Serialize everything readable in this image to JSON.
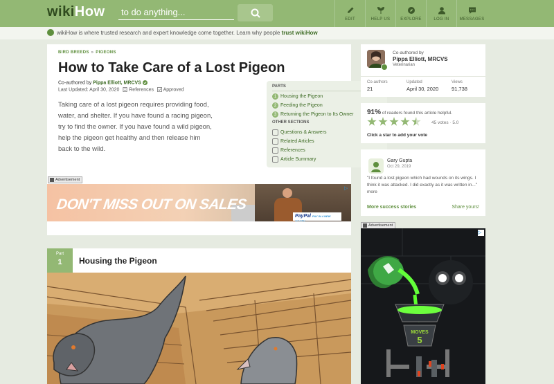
{
  "header": {
    "logo_wiki": "wiki",
    "logo_how": "How",
    "search_placeholder": "to do anything...",
    "nav": [
      {
        "label": "EDIT",
        "icon": "pencil-icon"
      },
      {
        "label": "HELP US",
        "icon": "leaf-icon"
      },
      {
        "label": "EXPLORE",
        "icon": "compass-icon"
      },
      {
        "label": "LOG IN",
        "icon": "user-icon"
      },
      {
        "label": "MESSAGES",
        "icon": "chat-icon"
      }
    ]
  },
  "tagline": {
    "text": "wikiHow is where trusted research and expert knowledge come together. Learn why people ",
    "bold": "trust wikiHow"
  },
  "article": {
    "breadcrumb": [
      "BIRD BREEDS",
      "PIGEONS"
    ],
    "title": "How to Take Care of a Lost Pigeon",
    "coauthor_prefix": "Co-authored by ",
    "coauthor_name": "Pippa Elliott, MRCVS",
    "updated": "Last Updated: April 30, 2020",
    "references": "References",
    "approved": "Approved",
    "intro": "Taking care of a lost pigeon requires providing food, water, and shelter. If you have found a racing pigeon, try to find the owner. If you have found a wild pigeon, help the pigeon get healthy and then release him back to the wild."
  },
  "toc": {
    "parts_heading": "PARTS",
    "parts": [
      {
        "num": "1",
        "label": "Housing the Pigeon"
      },
      {
        "num": "2",
        "label": "Feeding the Pigeon"
      },
      {
        "num": "3",
        "label": "Returning the Pigeon to Its Owner"
      }
    ],
    "other_heading": "OTHER SECTIONS",
    "others": [
      "Questions & Answers",
      "Related Articles",
      "References",
      "Article Summary"
    ]
  },
  "ads": {
    "badge": "Advertisement",
    "banner_text": "DON'T MISS OUT ON SALES",
    "paypal_a": "PayPal",
    "paypal_b": "PAY IN 4 NEW MONEY"
  },
  "section": {
    "part_word": "Part",
    "part_number": "1",
    "title": "Housing the Pigeon"
  },
  "sidebar": {
    "coauthor_label": "Co-authored by",
    "coauthor_name": "Pippa Elliott, MRCVS",
    "coauthor_role": "Veterinarian",
    "stats": [
      {
        "label": "Co-authors",
        "value": "21"
      },
      {
        "label": "Updated",
        "value": "April 30, 2020"
      },
      {
        "label": "Views",
        "value": "91,738"
      }
    ],
    "rating_percent": "91%",
    "rating_text": " of readers found this article helpful.",
    "stars": 4.5,
    "votes": "45 votes · 5.0",
    "rating_cta": "Click a star to add your vote",
    "story_name": "Gary Gupta",
    "story_date": "Oct 29, 2019",
    "story_text": "\"I found a lost pigeon which had wounds on its wings. I think it was attacked. I did exactly as it was written in...\" more",
    "more_stories": "More success stories",
    "share_story": "Share yours!"
  },
  "game_ad": {
    "moves_label": "MOVES",
    "moves_value": "5"
  },
  "colors": {
    "brand": "#93b874",
    "brand_dark": "#3d6b24",
    "background": "#e6ebe1"
  }
}
